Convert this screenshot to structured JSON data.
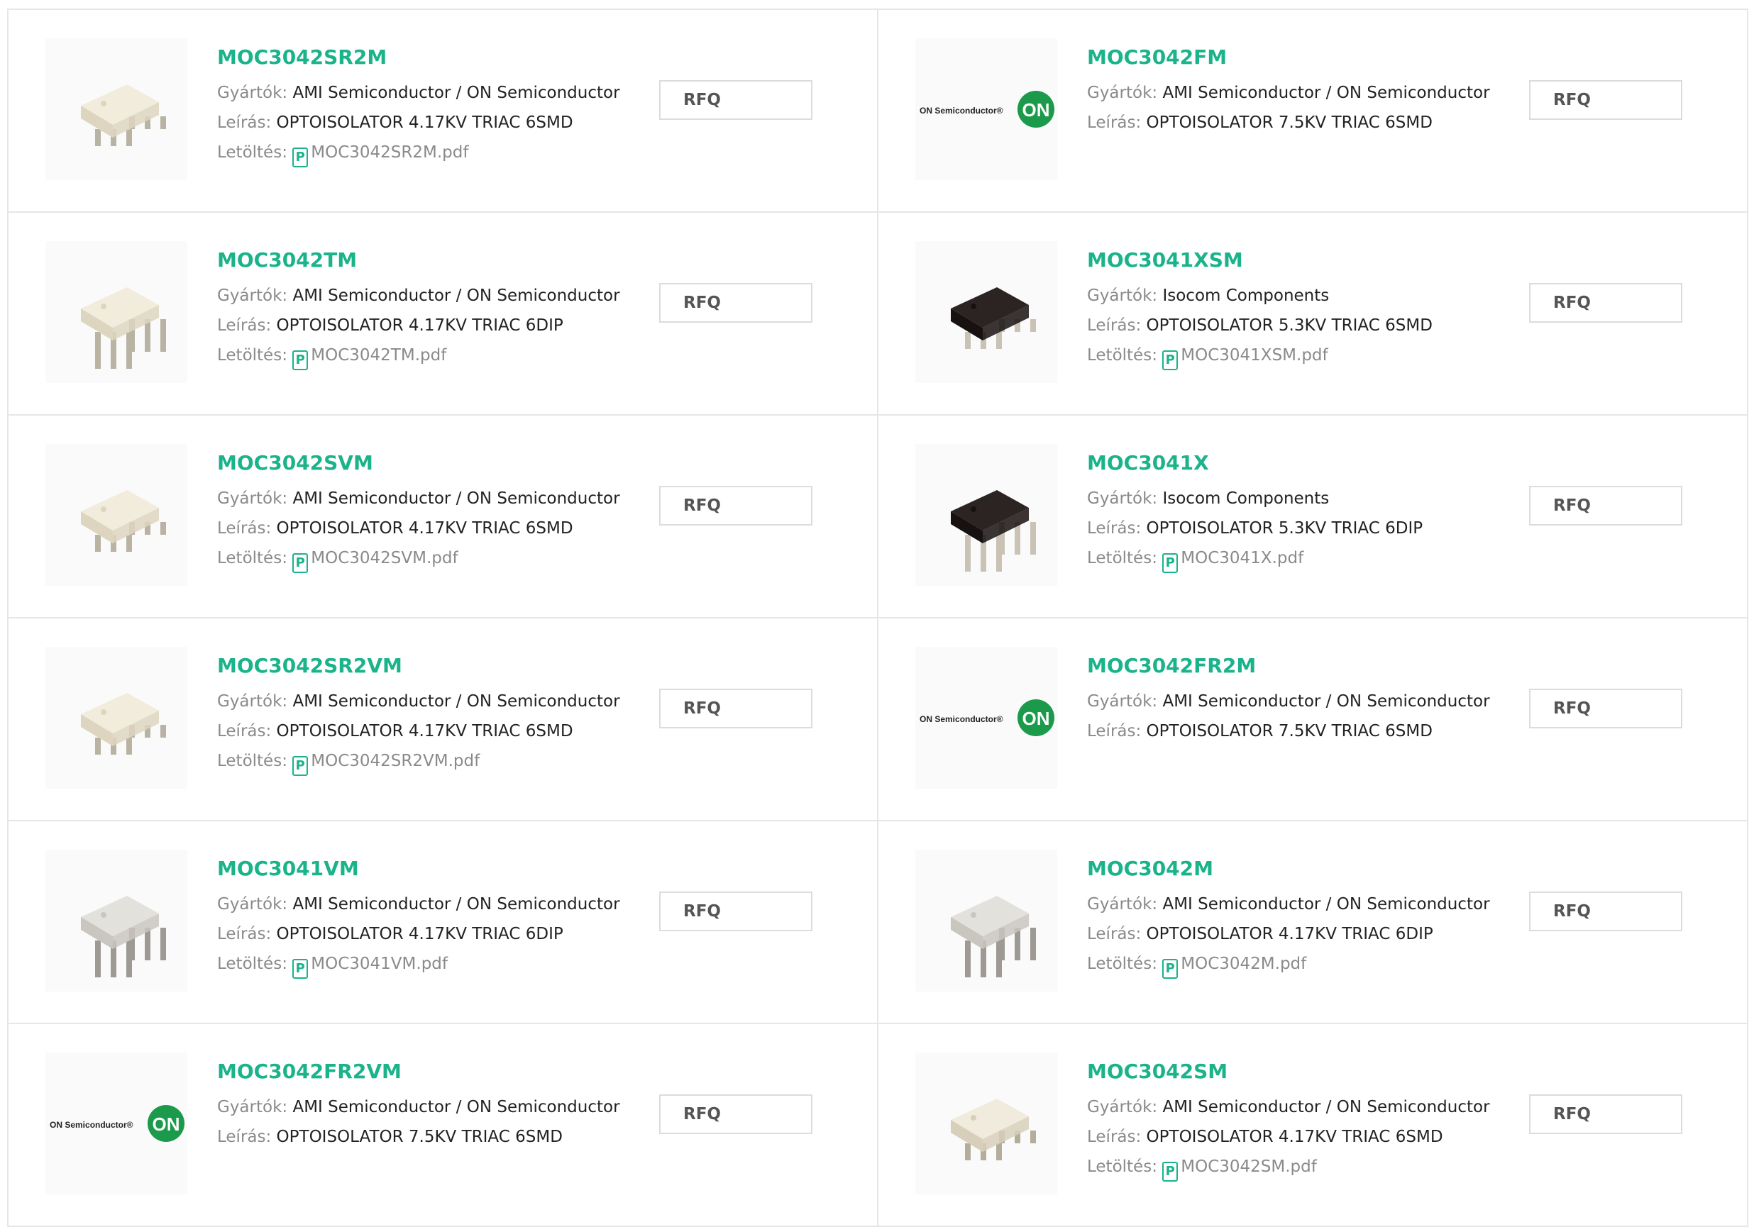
{
  "labels": {
    "manufacturer": "Gyártók:",
    "description": "Leírás:",
    "download": "Letöltés:",
    "rfq": "RFQ",
    "on_logo_text": "ON Semiconductor",
    "on_logo_badge": "ON"
  },
  "colors": {
    "accent": "#1ab38a",
    "on_green": "#1a9a4a"
  },
  "products": [
    {
      "name": "MOC3042SR2M",
      "manufacturer": "AMI Semiconductor / ON Semiconductor",
      "description": "OPTOISOLATOR 4.17KV TRIAC 6SMD",
      "pdf": "MOC3042SR2M.pdf",
      "image": "chip-white-smd"
    },
    {
      "name": "MOC3042FM",
      "manufacturer": "AMI Semiconductor / ON Semiconductor",
      "description": "OPTOISOLATOR 7.5KV TRIAC 6SMD",
      "pdf": "",
      "image": "on-semiconductor-logo"
    },
    {
      "name": "MOC3042TM",
      "manufacturer": "AMI Semiconductor / ON Semiconductor",
      "description": "OPTOISOLATOR 4.17KV TRIAC 6DIP",
      "pdf": "MOC3042TM.pdf",
      "image": "chip-white-dip"
    },
    {
      "name": "MOC3041XSM",
      "manufacturer": "Isocom Components",
      "description": "OPTOISOLATOR 5.3KV TRIAC 6SMD",
      "pdf": "MOC3041XSM.pdf",
      "image": "chip-black-smd"
    },
    {
      "name": "MOC3042SVM",
      "manufacturer": "AMI Semiconductor / ON Semiconductor",
      "description": "OPTOISOLATOR 4.17KV TRIAC 6SMD",
      "pdf": "MOC3042SVM.pdf",
      "image": "chip-white-smd"
    },
    {
      "name": "MOC3041X",
      "manufacturer": "Isocom Components",
      "description": "OPTOISOLATOR 5.3KV TRIAC 6DIP",
      "pdf": "MOC3041X.pdf",
      "image": "chip-black-dip"
    },
    {
      "name": "MOC3042SR2VM",
      "manufacturer": "AMI Semiconductor / ON Semiconductor",
      "description": "OPTOISOLATOR 4.17KV TRIAC 6SMD",
      "pdf": "MOC3042SR2VM.pdf",
      "image": "chip-white-smd"
    },
    {
      "name": "MOC3042FR2M",
      "manufacturer": "AMI Semiconductor / ON Semiconductor",
      "description": "OPTOISOLATOR 7.5KV TRIAC 6SMD",
      "pdf": "",
      "image": "on-semiconductor-logo"
    },
    {
      "name": "MOC3041VM",
      "manufacturer": "AMI Semiconductor / ON Semiconductor",
      "description": "OPTOISOLATOR 4.17KV TRIAC 6DIP",
      "pdf": "MOC3041VM.pdf",
      "image": "chip-gray-dip"
    },
    {
      "name": "MOC3042M",
      "manufacturer": "AMI Semiconductor / ON Semiconductor",
      "description": "OPTOISOLATOR 4.17KV TRIAC 6DIP",
      "pdf": "MOC3042M.pdf",
      "image": "chip-gray-dip"
    },
    {
      "name": "MOC3042FR2VM",
      "manufacturer": "AMI Semiconductor / ON Semiconductor",
      "description": "OPTOISOLATOR 7.5KV TRIAC 6SMD",
      "pdf": "",
      "image": "on-semiconductor-logo"
    },
    {
      "name": "MOC3042SM",
      "manufacturer": "AMI Semiconductor / ON Semiconductor",
      "description": "OPTOISOLATOR 4.17KV TRIAC 6SMD",
      "pdf": "MOC3042SM.pdf",
      "image": "chip-cream-smd"
    }
  ]
}
